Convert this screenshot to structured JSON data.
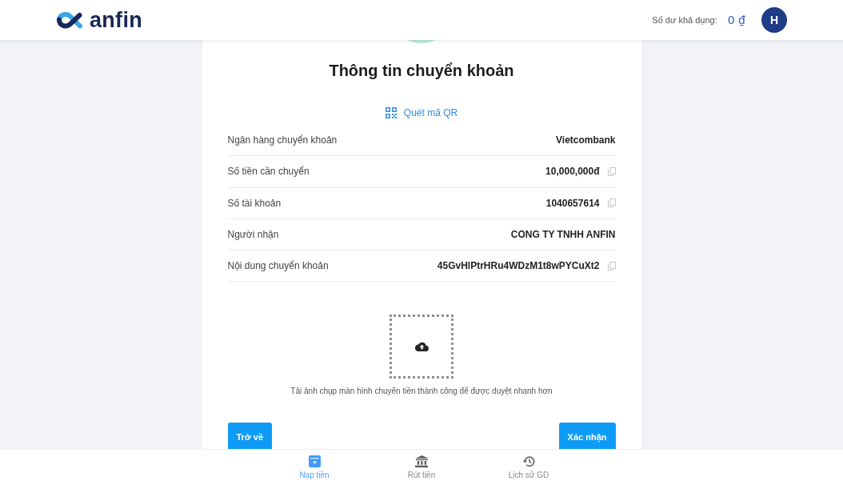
{
  "header": {
    "logo_text": "anfin",
    "balance_label": "Số dư khả dụng:",
    "balance_value": "0 ₫",
    "avatar_initial": "H"
  },
  "card": {
    "title": "Thông tin chuyển khoản",
    "qr_link": "Quét mã QR",
    "details": [
      {
        "label": "Ngân hàng chuyển khoản",
        "value": "Vietcombank",
        "copyable": false
      },
      {
        "label": "Số tiền cần chuyển",
        "value": "10,000,000đ",
        "copyable": true
      },
      {
        "label": "Số tài khoản",
        "value": "1040657614",
        "copyable": true
      },
      {
        "label": "Người nhận",
        "value": "CONG TY TNHH ANFIN",
        "copyable": false
      },
      {
        "label": "Nội dung chuyển khoản",
        "value": "45GvHlPtrHRu4WDzM1t8wPYCuXt2",
        "copyable": true
      }
    ],
    "upload_hint": "Tải ảnh chụp màn hình chuyển tiền thành công để được duyệt nhanh hơn",
    "buttons": [
      "Trở về",
      "Xác nhận"
    ]
  },
  "bottom_nav": [
    {
      "label": "Nạp tiền",
      "kind": "deposit",
      "selected": true
    },
    {
      "label": "Rút tiền",
      "kind": "bank",
      "selected": false
    },
    {
      "label": "Lịch sử GD",
      "kind": "history",
      "selected": false
    }
  ]
}
